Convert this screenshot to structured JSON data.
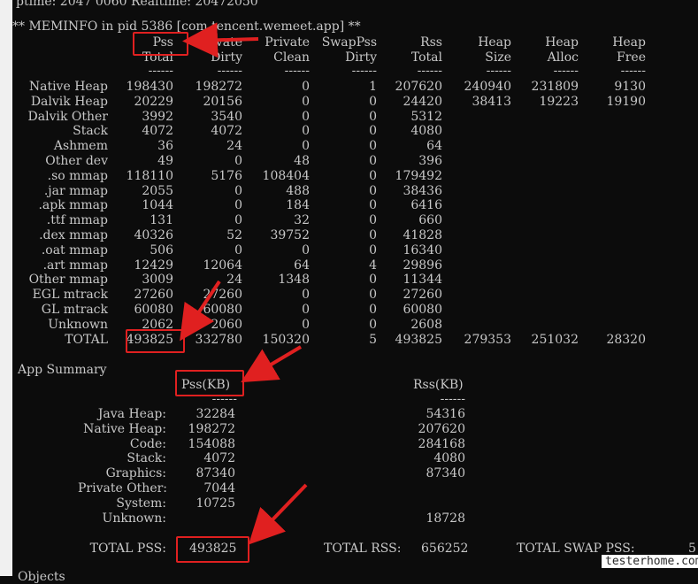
{
  "uptime_partial": "ptime: 2047 0060 Realtime: 20472050",
  "meminfo_header": "** MEMINFO in pid 5386 [com.tencent.wemeet.app] **",
  "columns": [
    {
      "top": "Pss",
      "bottom": "Total"
    },
    {
      "top": "Private",
      "bottom": "Dirty"
    },
    {
      "top": "Private",
      "bottom": "Clean"
    },
    {
      "top": "SwapPss",
      "bottom": "Dirty"
    },
    {
      "top": "Rss",
      "bottom": "Total"
    },
    {
      "top": "Heap",
      "bottom": "Size"
    },
    {
      "top": "Heap",
      "bottom": "Alloc"
    },
    {
      "top": "Heap",
      "bottom": "Free"
    }
  ],
  "separator": "------",
  "rows": [
    {
      "name": "Native Heap",
      "values": [
        "198430",
        "198272",
        "0",
        "1",
        "207620",
        "240940",
        "231809",
        "9130"
      ]
    },
    {
      "name": "Dalvik Heap",
      "values": [
        "20229",
        "20156",
        "0",
        "0",
        "24420",
        "38413",
        "19223",
        "19190"
      ]
    },
    {
      "name": "Dalvik Other",
      "values": [
        "3992",
        "3540",
        "0",
        "0",
        "5312",
        "",
        "",
        ""
      ]
    },
    {
      "name": "Stack",
      "values": [
        "4072",
        "4072",
        "0",
        "0",
        "4080",
        "",
        "",
        ""
      ]
    },
    {
      "name": "Ashmem",
      "values": [
        "36",
        "24",
        "0",
        "0",
        "64",
        "",
        "",
        ""
      ]
    },
    {
      "name": "Other dev",
      "values": [
        "49",
        "0",
        "48",
        "0",
        "396",
        "",
        "",
        ""
      ]
    },
    {
      "name": ".so mmap",
      "values": [
        "118110",
        "5176",
        "108404",
        "0",
        "179492",
        "",
        "",
        ""
      ]
    },
    {
      "name": ".jar mmap",
      "values": [
        "2055",
        "0",
        "488",
        "0",
        "38436",
        "",
        "",
        ""
      ]
    },
    {
      "name": ".apk mmap",
      "values": [
        "1044",
        "0",
        "184",
        "0",
        "6416",
        "",
        "",
        ""
      ]
    },
    {
      "name": ".ttf mmap",
      "values": [
        "131",
        "0",
        "32",
        "0",
        "660",
        "",
        "",
        ""
      ]
    },
    {
      "name": ".dex mmap",
      "values": [
        "40326",
        "52",
        "39752",
        "0",
        "41828",
        "",
        "",
        ""
      ]
    },
    {
      "name": ".oat mmap",
      "values": [
        "506",
        "0",
        "0",
        "0",
        "16340",
        "",
        "",
        ""
      ]
    },
    {
      "name": ".art mmap",
      "values": [
        "12429",
        "12064",
        "64",
        "4",
        "29896",
        "",
        "",
        ""
      ]
    },
    {
      "name": "Other mmap",
      "values": [
        "3009",
        "24",
        "1348",
        "0",
        "11344",
        "",
        "",
        ""
      ]
    },
    {
      "name": "EGL mtrack",
      "values": [
        "27260",
        "27260",
        "0",
        "0",
        "27260",
        "",
        "",
        ""
      ]
    },
    {
      "name": "GL mtrack",
      "values": [
        "60080",
        "60080",
        "0",
        "0",
        "60080",
        "",
        "",
        ""
      ]
    },
    {
      "name": "Unknown",
      "values": [
        "2062",
        "2060",
        "0",
        "0",
        "2608",
        "",
        "",
        ""
      ]
    },
    {
      "name": "TOTAL",
      "values": [
        "493825",
        "332780",
        "150320",
        "5",
        "493825",
        "279353",
        "251032",
        "28320"
      ]
    }
  ],
  "app_summary": {
    "title": "App Summary",
    "pss_header": "Pss(KB)",
    "rss_header": "Rss(KB)",
    "items": [
      {
        "label": "Java Heap:",
        "pss": "32284",
        "rss": "54316"
      },
      {
        "label": "Native Heap:",
        "pss": "198272",
        "rss": "207620"
      },
      {
        "label": "Code:",
        "pss": "154088",
        "rss": "284168"
      },
      {
        "label": "Stack:",
        "pss": "4072",
        "rss": "4080"
      },
      {
        "label": "Graphics:",
        "pss": "87340",
        "rss": "87340"
      },
      {
        "label": "Private Other:",
        "pss": "7044",
        "rss": ""
      },
      {
        "label": "System:",
        "pss": "10725",
        "rss": ""
      },
      {
        "label": "Unknown:",
        "pss": "",
        "rss": "18728"
      }
    ],
    "total_pss_label": "TOTAL PSS:",
    "total_pss": "493825",
    "total_rss_label": "TOTAL RSS:",
    "total_rss": "656252",
    "total_swap_label": "TOTAL SWAP PSS:",
    "total_swap_partial": "5"
  },
  "bottom_partial": "Objects",
  "watermark": "testerhome.com",
  "colors": {
    "terminal_bg": "#0c0c0c",
    "text": "#c8c8c8",
    "highlight": "#e02020"
  }
}
